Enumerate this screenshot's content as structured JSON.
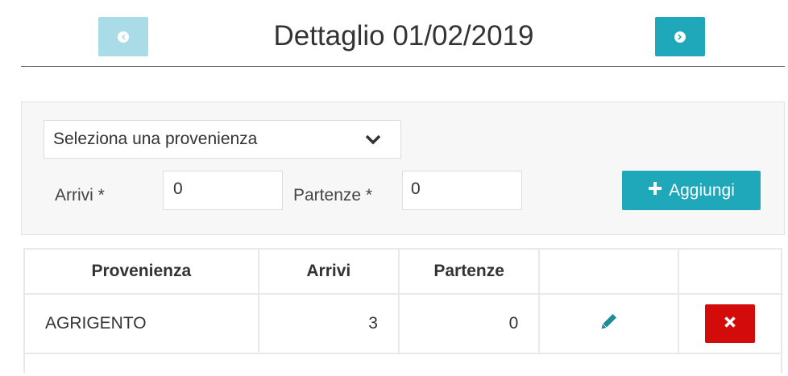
{
  "header": {
    "title": "Dettaglio 01/02/2019",
    "prev_icon": "arrow-circle-left-icon",
    "next_icon": "arrow-circle-right-icon"
  },
  "form": {
    "select_placeholder": "Seleziona una provenienza",
    "arrivi_label": "Arrivi *",
    "arrivi_value": "0",
    "partenze_label": "Partenze *",
    "partenze_value": "0",
    "add_button_label": "Aggiungi"
  },
  "table": {
    "headers": [
      "Provenienza",
      "Arrivi",
      "Partenze",
      "",
      ""
    ],
    "rows": [
      {
        "provenienza": "AGRIGENTO",
        "arrivi": "3",
        "partenze": "0"
      }
    ]
  },
  "colors": {
    "primary": "#1fa8b9",
    "primary_disabled": "#a9dce6",
    "danger": "#d40b0b"
  }
}
